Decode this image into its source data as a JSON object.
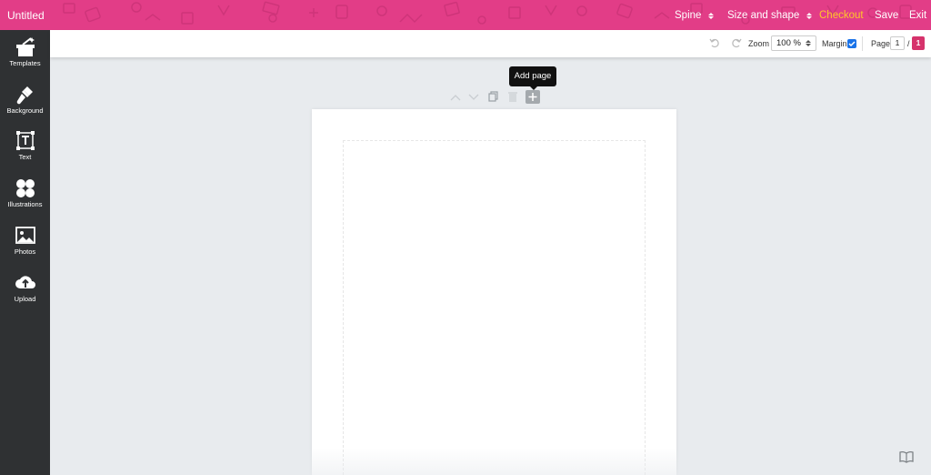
{
  "app": {
    "title": "Untitled"
  },
  "topbar": {
    "spine_label": "Spine",
    "size_label": "Size and shape",
    "checkout_label": "Checkout",
    "save_label": "Save",
    "exit_label": "Exit",
    "bg_color": "#e23d87",
    "checkout_color": "#ffc629"
  },
  "sidebar": {
    "items": [
      {
        "label": "Templates",
        "icon": "magic-wand-icon"
      },
      {
        "label": "Background",
        "icon": "paint-brush-icon"
      },
      {
        "label": "Text",
        "icon": "text-box-icon"
      },
      {
        "label": "Illustrations",
        "icon": "clover-icon"
      },
      {
        "label": "Photos",
        "icon": "image-icon"
      },
      {
        "label": "Upload",
        "icon": "cloud-upload-icon"
      }
    ]
  },
  "toolbar": {
    "zoom_label": "Zoom",
    "zoom_value": "100 %",
    "margin_label": "Margin",
    "margin_checked": true,
    "page_label": "Page:",
    "current_page": "1",
    "page_separator": "/",
    "total_pages": "1"
  },
  "tooltip": {
    "text": "Add page"
  }
}
